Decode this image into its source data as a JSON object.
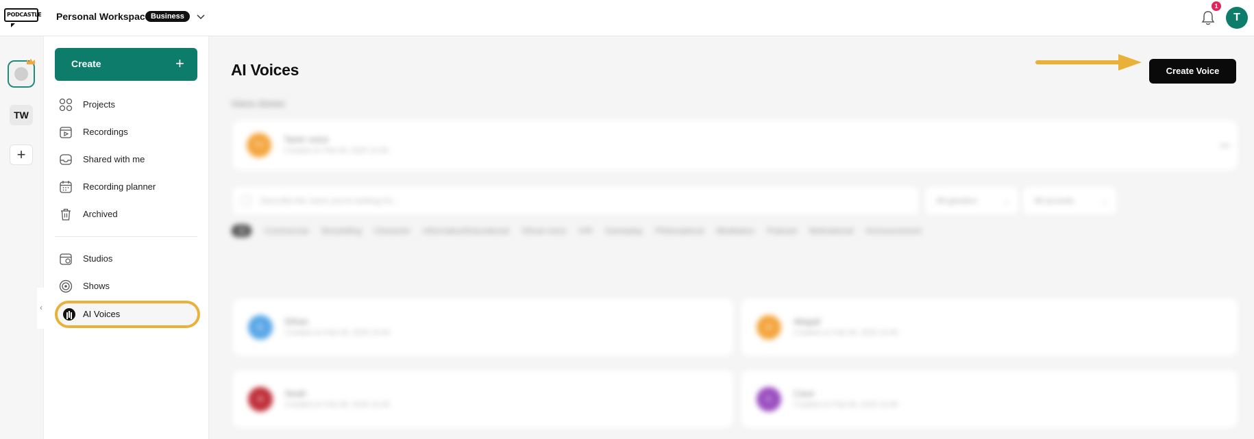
{
  "topbar": {
    "logo_text": "PODCASTLE",
    "workspace_name": "Personal Workspace",
    "plan_badge": "Business",
    "notification_count": "1",
    "user_initial": "T"
  },
  "rail": {
    "workspace_initials": "TW",
    "add_symbol": "+",
    "collapse_symbol": "‹"
  },
  "sidebar": {
    "create_label": "Create",
    "create_symbol": "+",
    "items": [
      {
        "label": "Projects",
        "icon": "grid-icon"
      },
      {
        "label": "Recordings",
        "icon": "recordings-icon"
      },
      {
        "label": "Shared with me",
        "icon": "inbox-icon"
      },
      {
        "label": "Recording planner",
        "icon": "calendar-icon"
      },
      {
        "label": "Archived",
        "icon": "trash-icon"
      },
      {
        "label": "Studios",
        "icon": "studio-calendar-icon"
      },
      {
        "label": "Shows",
        "icon": "broadcast-icon"
      },
      {
        "label": "AI Voices",
        "icon": "ai-voice-icon"
      }
    ]
  },
  "main": {
    "title": "AI Voices",
    "create_voice_label": "Create Voice",
    "section_label": "Voice clones",
    "clone": {
      "initials": "TV",
      "name": "Tamir voice",
      "sub": "Created on Feb 06, 2025 10:45"
    },
    "search_placeholder": "Describe the voice you're looking for...",
    "filter_gender": "All genders",
    "filter_accent": "All accents",
    "chips": [
      "All",
      "Commercial",
      "Storytelling",
      "Character",
      "Informative/Educational",
      "Virtual voice",
      "IVR",
      "Gameplay",
      "Philosophical",
      "Meditation",
      "Podcast",
      "Motivational",
      "Announcement"
    ],
    "voices": [
      {
        "initials": "E",
        "name": "Ethan",
        "sub": "Created on Feb 06, 2025 10:45",
        "color": "#5aa7e8"
      },
      {
        "initials": "A",
        "name": "Abigail",
        "sub": "Created on Feb 06, 2025 10:45",
        "color": "#f4a640"
      },
      {
        "initials": "N",
        "name": "Noah",
        "sub": "Created on Feb 06, 2025 10:45",
        "color": "#c0303a"
      },
      {
        "initials": "C",
        "name": "Cave",
        "sub": "Created on Feb 06, 2025 10:45",
        "color": "#9b4fc0"
      }
    ]
  },
  "colors": {
    "brand": "#0e7c6b",
    "highlight": "#eab13a",
    "arrow": "#eab13a",
    "primary_button": "#0a0a0a"
  }
}
